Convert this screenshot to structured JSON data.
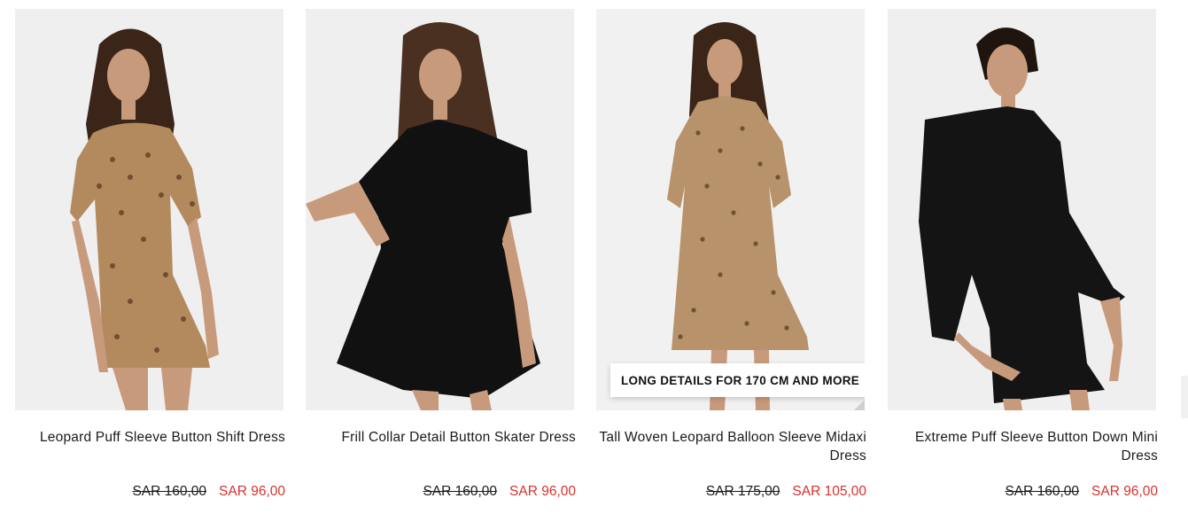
{
  "products": [
    {
      "title": "Leopard Puff Sleeve Button Shift Dress",
      "old_price": "SAR 160,00",
      "new_price": "SAR 96,00",
      "badge": null,
      "dress_color": "#b38a5e",
      "pattern": "leopard",
      "background": "#efefef"
    },
    {
      "title": "Frill Collar Detail Button Skater Dress",
      "old_price": "SAR 160,00",
      "new_price": "SAR 96,00",
      "badge": null,
      "dress_color": "#111111",
      "pattern": "solid",
      "background": "#efefef"
    },
    {
      "title": "Tall Woven Leopard Balloon Sleeve Midaxi Dress",
      "old_price": "SAR 175,00",
      "new_price": "SAR 105,00",
      "badge": "LONG DETAILS FOR 170 CM AND MORE",
      "dress_color": "#b7926a",
      "pattern": "leopard",
      "background": "#f1f1f1"
    },
    {
      "title": "Extreme Puff Sleeve Button Down Mini Dress",
      "old_price": "SAR 160,00",
      "new_price": "SAR 96,00",
      "badge": null,
      "dress_color": "#141414",
      "pattern": "solid",
      "background": "#efefef"
    }
  ],
  "colors": {
    "sale_price": "#d8312c",
    "text": "#1a1a1a",
    "skin": "#c89a7c",
    "hair": "#3b2418"
  }
}
